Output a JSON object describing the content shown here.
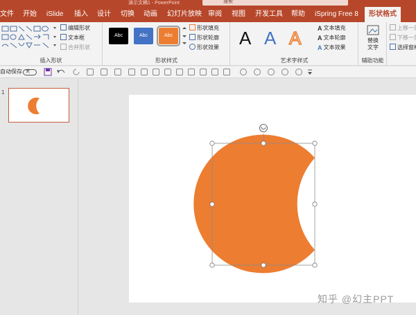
{
  "titlebar": {
    "title": "演示文稿1 - PowerPoint",
    "search_placeholder": "搜索"
  },
  "menu": {
    "tabs": [
      "文件",
      "开始",
      "iSlide",
      "插入",
      "设计",
      "切换",
      "动画",
      "幻灯片放映",
      "审阅",
      "视图",
      "开发工具",
      "帮助",
      "iSpring Free 8",
      "形状格式"
    ],
    "active": "形状格式"
  },
  "ribbon": {
    "insert_shapes": {
      "label": "插入形状",
      "edit_shape": "编辑形状",
      "textbox": "文本框",
      "merge_shapes": "合并形状"
    },
    "shape_styles": {
      "label": "形状样式",
      "swatch_text": "Abc",
      "fill": "形状填充",
      "outline": "形状轮廓",
      "effects": "形状效果"
    },
    "wordart_styles": {
      "label": "艺术字样式",
      "letter": "A",
      "text_fill": "文本填充",
      "text_outline": "文本轮廓",
      "text_effects": "文本效果"
    },
    "accessibility": {
      "label": "辅助功能",
      "alt_text_1": "替换",
      "alt_text_2": "文字"
    },
    "arrange": {
      "bring_forward": "上移一层",
      "send_backward": "下移一层",
      "selection_pane": "选择窗格"
    }
  },
  "qat": {
    "autosave": "自动保存",
    "toggle": "关"
  },
  "thumbnails": {
    "slide_number": "1"
  },
  "watermark": "知乎 @幻主PPT",
  "colors": {
    "accent": "#b7472a",
    "shape_fill": "#ed7d31",
    "swatch_black": "#000000",
    "swatch_blue": "#4472c4",
    "swatch_orange": "#ed7d31",
    "wordart_blue": "#4472c4",
    "wordart_orange": "#ed7d31"
  }
}
